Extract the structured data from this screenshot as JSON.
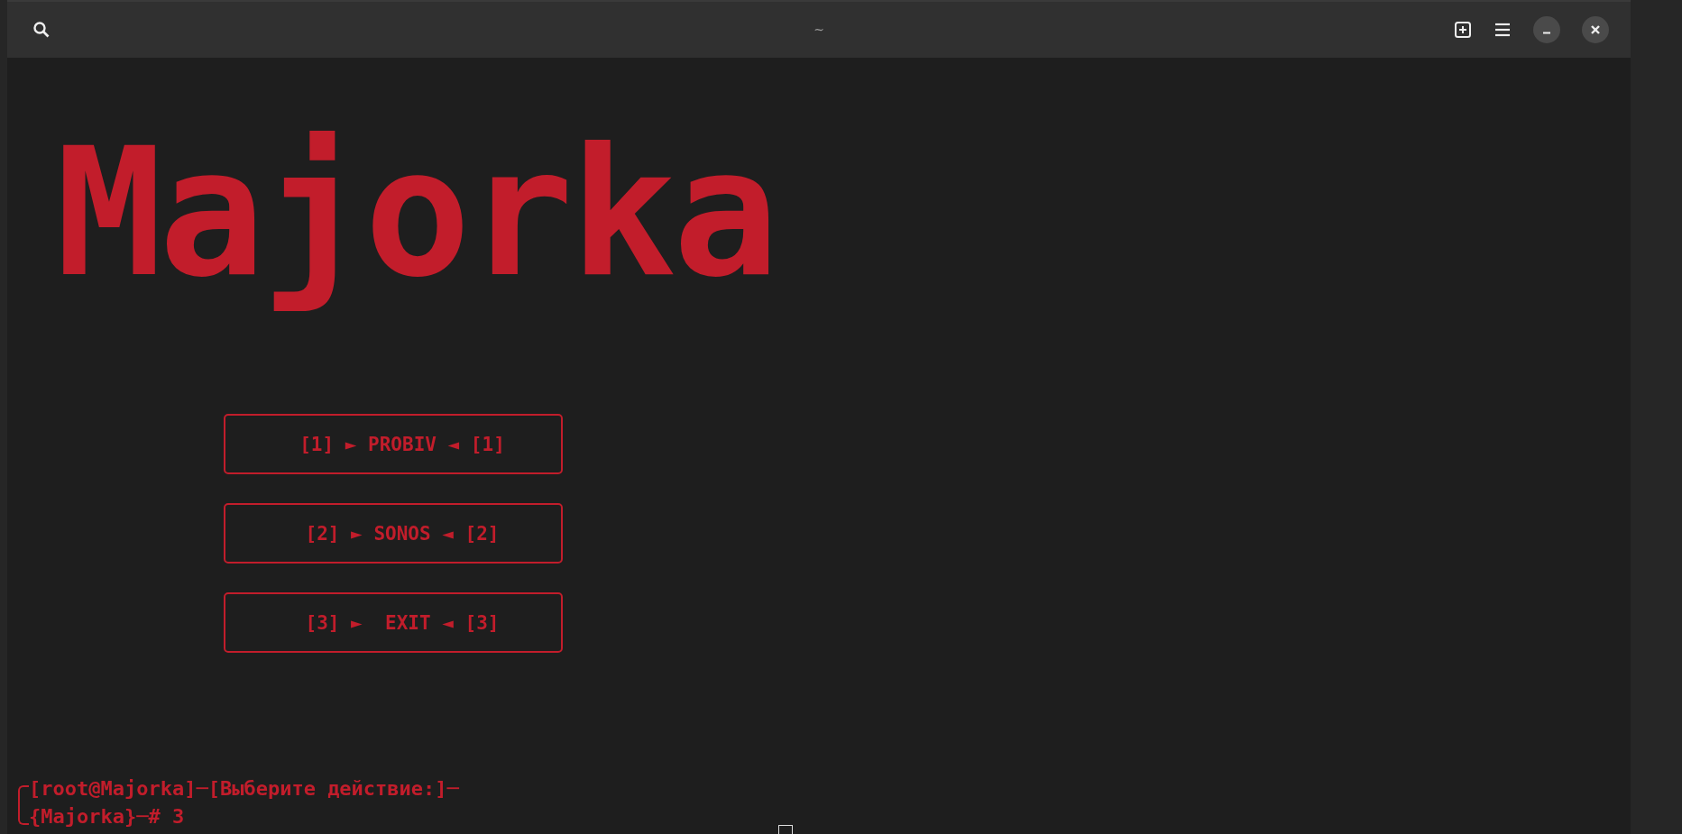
{
  "window": {
    "title": "~"
  },
  "logo": {
    "text": "Majorka"
  },
  "menu": [
    {
      "label": "[1] ► PROBIV ◄ [1]"
    },
    {
      "label": "[2] ► SONOS ◄ [2]"
    },
    {
      "label": "[3] ►  EXIT ◄ [3]"
    }
  ],
  "prompt": {
    "line_1": "[root@Majorka]─[Выберите действие:]─",
    "line_2": "{Majorka}─# 3"
  }
}
